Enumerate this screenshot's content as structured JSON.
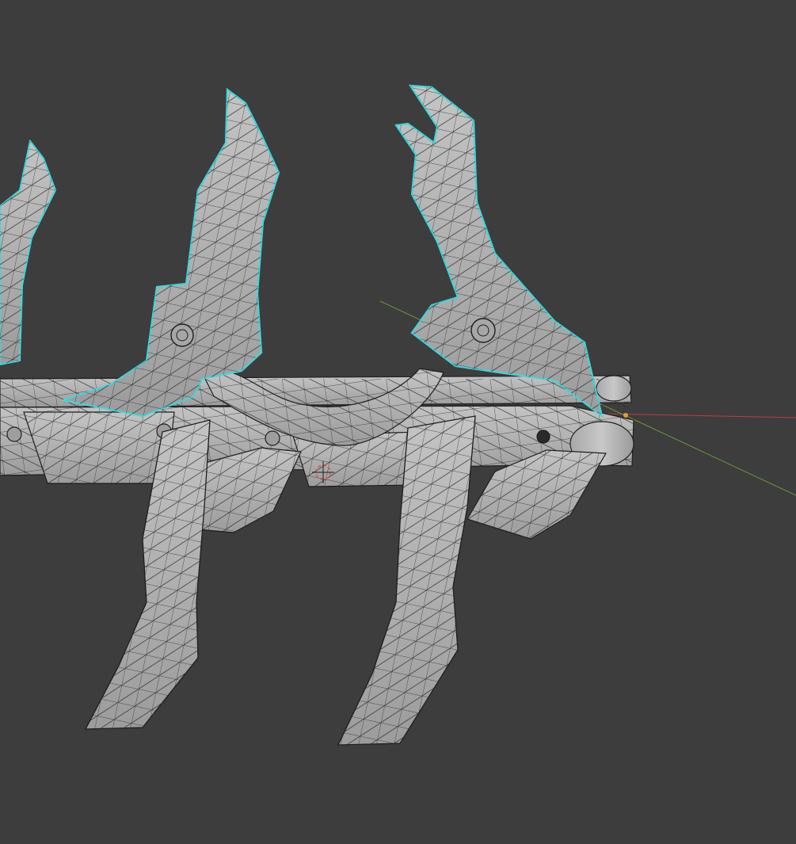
{
  "viewport": {
    "background": "#3d3d3d",
    "mesh_fill": "#b4b4b4",
    "mesh_shade": "#9a9a9a",
    "wire_color": "#1e1e1e",
    "selection_color": "#3fd6dc",
    "axis_x_color": "#c43a3a",
    "axis_y_color": "#6a9a3a",
    "origin_color": "#e89a3a",
    "mode": "edit-mode-wireframe-overlay"
  }
}
